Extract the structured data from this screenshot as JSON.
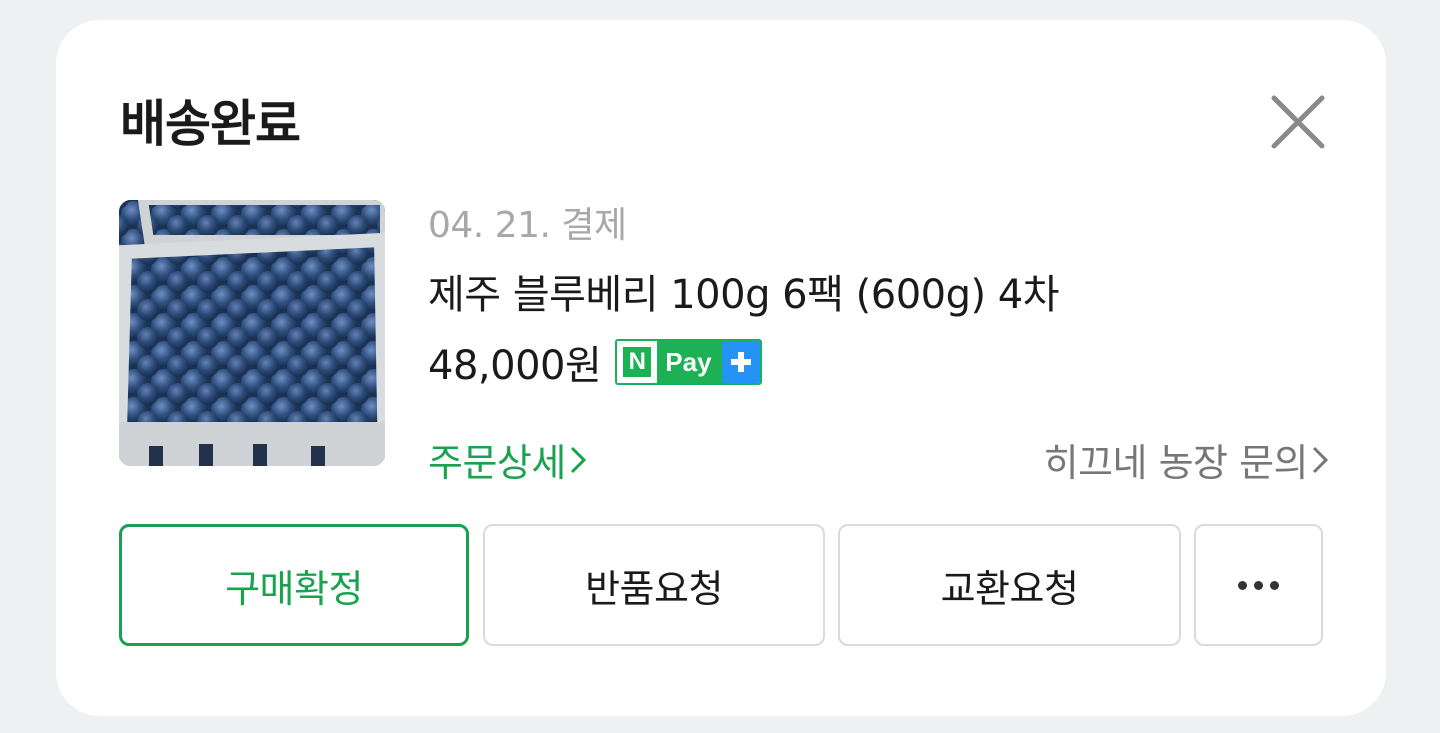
{
  "status_title": "배송완료",
  "close": {
    "icon": "close-icon"
  },
  "product": {
    "image_alt": "blueberries",
    "paid_date": "04. 21. 결제",
    "name": "제주 블루베리 100g 6팩 (600g) 4차",
    "price": "48,000원",
    "npay": {
      "n": "N",
      "pay": "Pay",
      "plus": "+"
    }
  },
  "links": {
    "order_detail": "주문상세",
    "seller_inquiry": "히끄네 농장 문의"
  },
  "buttons": {
    "confirm": "구매확정",
    "return": "반품요청",
    "exchange": "교환요청",
    "more_icon": "more-horizontal-icon"
  },
  "colors": {
    "accent_green": "#19a34f",
    "npay_green": "#1cb154",
    "npay_blue": "#2593f5",
    "muted_text": "#a8a8a8"
  }
}
